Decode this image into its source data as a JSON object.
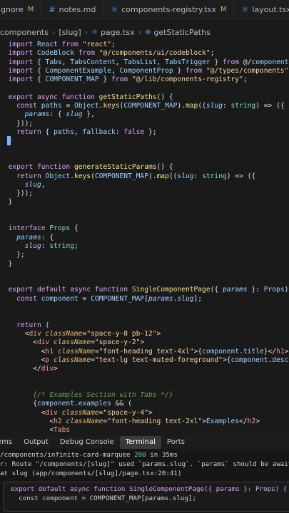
{
  "tabs": [
    {
      "label": "ignore",
      "modified": "M",
      "active": false
    },
    {
      "label": "notes.md",
      "modified": "",
      "active": false
    },
    {
      "label": "components-registry.tsx",
      "modified": "M",
      "active": false
    },
    {
      "label": "layout.tsx",
      "modified": "",
      "active": false
    }
  ],
  "breadcrumb": {
    "seg1": "components",
    "seg2": "[slug]",
    "seg3": "page.tsx",
    "seg4": "getStaticPaths"
  },
  "code_lines": [
    "  import React from \"react\";",
    "  import CodeBlock from \"@/components/ui/codeblock\";",
    "  import { Tabs, TabsContent, TabsList, TabsTrigger } from \"@/components",
    "  import { ComponentExample, ComponentProp } from \"@/types/components\";",
    "  import { COMPONENT_MAP } from \"@/lib/components-registry\";",
    "",
    "  export async function getStaticPaths() {",
    "    const paths = Object.keys(COMPONENT_MAP).map((slug: string) => ({",
    "      params: { slug },",
    "    }));",
    "    return { paths, fallback: false };",
    "  }",
    "",
    "",
    "  export function generateStaticParams() {",
    "    return Object.keys(COMPONENT_MAP).map((slug: string) => ({",
    "      slug,",
    "    }));",
    "  }",
    "",
    "",
    "  interface Props {",
    "    params: {",
    "      slug: string;",
    "    };",
    "  }",
    "",
    "",
    "  export default async function SingleComponentPage({ params }: Props) {",
    "    const component = COMPONENT_MAP[params.slug];",
    "",
    "",
    "    return (",
    "      <div className=\"space-y-8 pb-12\">",
    "        <div className=\"space-y-2\">",
    "          <h1 className=\"font-heading text-4xl\">{component.title}</h1>",
    "          <p className=\"text-lg text-muted-foreground\">{component.descri",
    "        </div>",
    "",
    "",
    "        {/* Examples Section with Tabs */}",
    "        {component.examples && (",
    "          <div className=\"space-y-4\">",
    "            <h2 className=\"font-heading text-2xl\">Examples</h2>",
    "            <Tabs"
  ],
  "panel_tabs": [
    {
      "label": "ems",
      "active": false
    },
    {
      "label": "Output",
      "active": false
    },
    {
      "label": "Debug Console",
      "active": false
    },
    {
      "label": "Terminal",
      "active": true
    },
    {
      "label": "Ports",
      "active": false
    }
  ],
  "terminal": {
    "line1_prefix": "/components/infinite-card-marquee ",
    "line1_status": "200",
    "line1_suffix": " in 35ms",
    "line2": "r: Route \"/components/[slug]\" used `params.slug`. `params` should be awaite",
    "line3": "at slug (app/components/[slug]/page.tsx:20:41)",
    "box_line1": "export default async function SingleComponentPage({ params }: Props) {",
    "box_line2": "  const component = COMPONENT_MAP[params.slug];"
  },
  "colors": {
    "editor_bg": "#1a1a1a",
    "accent": "#4aa3ff",
    "keyword": "#d7a7f0",
    "string": "#f7d2a0",
    "function": "#f2e08a"
  }
}
